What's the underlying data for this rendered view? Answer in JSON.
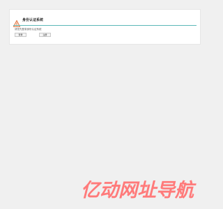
{
  "dialog": {
    "title": "身份认证系统",
    "message": "请您先登录身份认证系统",
    "buttons": {
      "primary_label": "登录",
      "secondary_label": "注册"
    },
    "icon": "warning-triangle-icon",
    "colors": {
      "rule": "#5cb8b8",
      "icon": "#e0703c"
    }
  },
  "watermark": {
    "text": "亿动网址导航",
    "color": "#ff7a7a"
  }
}
